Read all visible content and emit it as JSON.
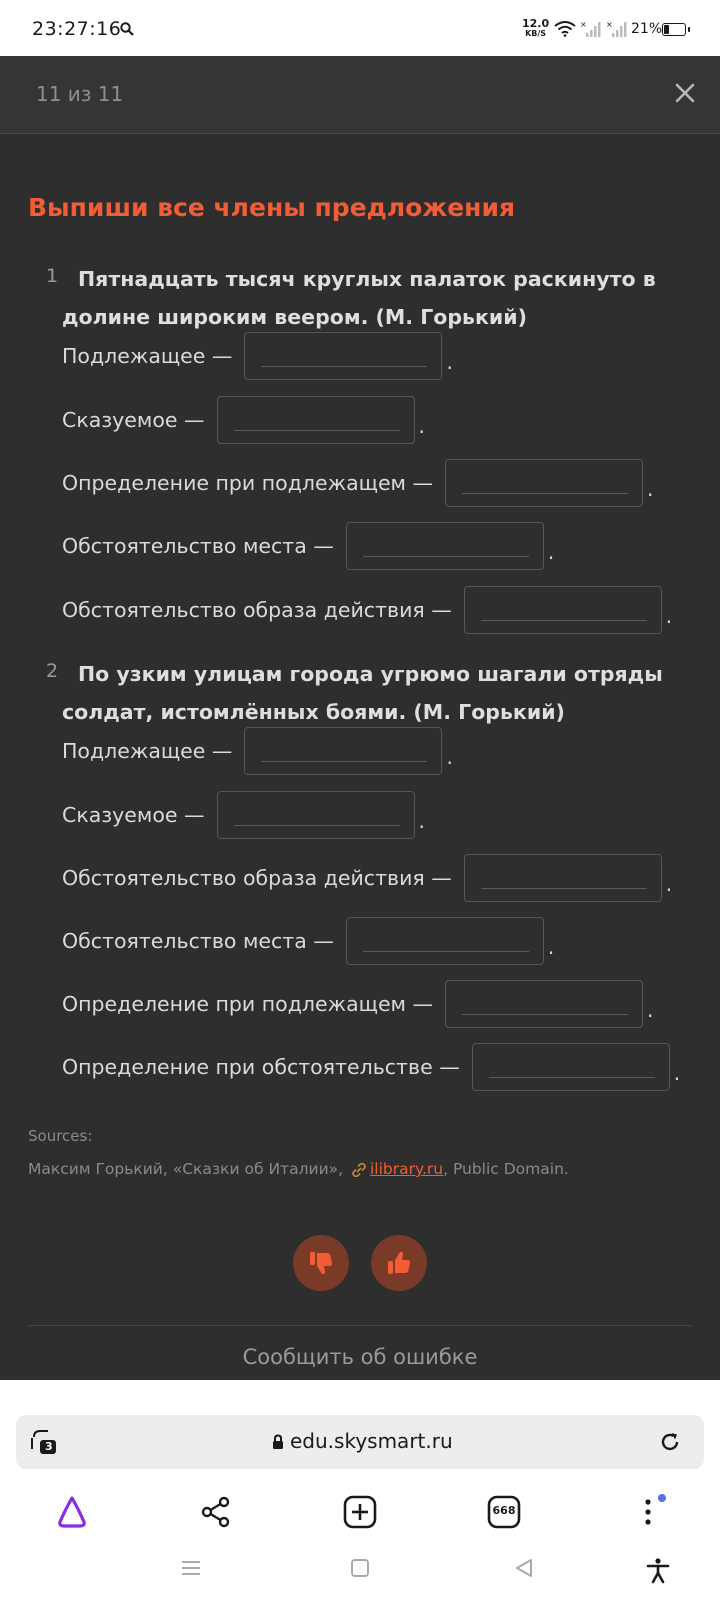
{
  "status_bar": {
    "time": "23:27:16",
    "net_speed_value": "12.0",
    "net_speed_unit": "KB/S",
    "battery": "21%"
  },
  "header": {
    "counter": "11 из 11"
  },
  "task": {
    "title": "Выпиши все члены предложения",
    "questions": [
      {
        "number": "1",
        "sentence": "Пятнадцать тысяч круглых палаток раскинуто в долине широким веером. (М. Горький)",
        "rows": [
          {
            "label": "Подлежащее —",
            "value": ""
          },
          {
            "label": "Сказуемое —",
            "value": ""
          },
          {
            "label": "Определение при подлежащем —",
            "value": ""
          },
          {
            "label": "Обстоятельство места —",
            "value": ""
          },
          {
            "label": "Обстоятельство образа действия —",
            "value": ""
          }
        ]
      },
      {
        "number": "2",
        "sentence": "По узким улицам города угрюмо шагали отряды солдат, истомлённых боями. (М. Горький)",
        "rows": [
          {
            "label": "Подлежащее —",
            "value": ""
          },
          {
            "label": "Сказуемое —",
            "value": ""
          },
          {
            "label": "Обстоятельство образа действия —",
            "value": ""
          },
          {
            "label": "Обстоятельство места —",
            "value": ""
          },
          {
            "label": "Определение при подлежащем —",
            "value": ""
          },
          {
            "label": "Определение при обстоятельстве —",
            "value": ""
          }
        ]
      }
    ],
    "period": "."
  },
  "sources": {
    "label": "Sources:",
    "prefix": "Максим Горький, «Сказки об Италии»,",
    "link_text": "ilibrary.ru",
    "suffix": ", Public Domain."
  },
  "feedback": {
    "report_label": "Сообщить об ошибке"
  },
  "browser": {
    "tab_count": "3",
    "url": "edu.skysmart.ru",
    "tabs_grid_count": "668"
  },
  "colors": {
    "accent": "#f25d35",
    "background": "#2e2e2e",
    "browser_accent": "#8a2be2"
  }
}
